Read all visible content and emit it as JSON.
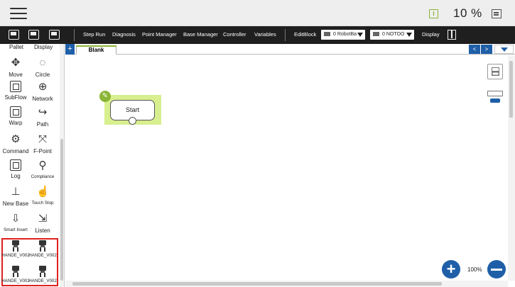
{
  "topbar": {
    "speed": "10 %",
    "menu_icon": "hamburger-menu-icon",
    "info_icon": "info-icon",
    "speed_icon": "speed-panel-icon"
  },
  "toolbar": {
    "items": [
      "Step Run",
      "Diagnosis",
      "Point Manager",
      "Base Manager",
      "Controller",
      "Variables"
    ],
    "editblock": "EditBlock",
    "robot_base": "0 RobotBa",
    "tool": "0 NOTOO",
    "display": "Display"
  },
  "sidebar": {
    "partial": [
      "Pallet",
      "Display"
    ],
    "tools": [
      "Move",
      "Circle",
      "SubFlow",
      "Network",
      "Warp",
      "Path",
      "Command",
      "F-Point",
      "Log",
      "Compliance",
      "New Base",
      "Touch Stop",
      "Smart Insert",
      "Listen"
    ],
    "hande": [
      "HANDE_V002",
      "HANDE_V002",
      "HANDE_V002",
      "HANDE_V002"
    ]
  },
  "tabs": {
    "add": "+",
    "active": "Blank",
    "prev": "<",
    "next": ">"
  },
  "canvas": {
    "start_label": "Start",
    "zoom": "100%"
  },
  "colors": {
    "accent": "#1f5fa8",
    "highlight": "#e0201f",
    "green": "#8ab536"
  }
}
